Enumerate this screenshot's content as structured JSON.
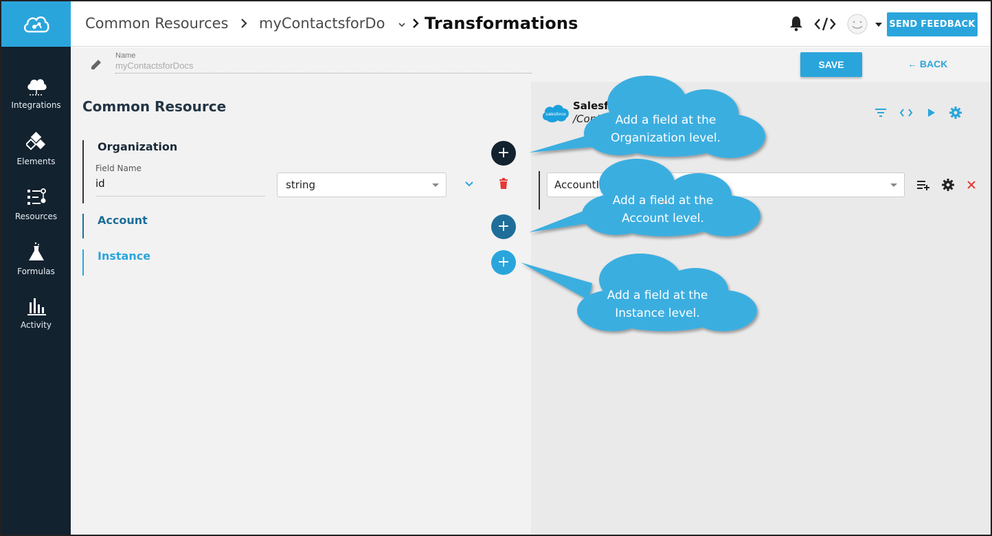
{
  "breadcrumb": {
    "item1": "Common Resources",
    "item2": "myContactsforDo",
    "title": "Transformations"
  },
  "topbar": {
    "feedback_label": "SEND FEEDBACK"
  },
  "sidebar": {
    "items": [
      {
        "label": "Integrations",
        "icon": "cloud-icon"
      },
      {
        "label": "Elements",
        "icon": "elements-icon"
      },
      {
        "label": "Resources",
        "icon": "resources-icon"
      },
      {
        "label": "Formulas",
        "icon": "flask-icon"
      },
      {
        "label": "Activity",
        "icon": "bar-chart-icon"
      }
    ]
  },
  "subheader": {
    "name_label": "Name",
    "name_value": "myContactsforDocs",
    "save_label": "SAVE",
    "back_label": "← BACK"
  },
  "left_panel": {
    "title": "Common Resource",
    "levels": [
      {
        "title": "Organization",
        "color": "#1b2a38"
      },
      {
        "title": "Account",
        "color": "#1e6e99"
      },
      {
        "title": "Instance",
        "color": "#2aa5dc"
      }
    ],
    "field_label": "Field Name",
    "field_value": "id",
    "type_value": "string"
  },
  "right_panel": {
    "logo_text": "salesforce",
    "title": "Salesf",
    "path": "/Cont",
    "mapping_value": "AccountId"
  },
  "callouts": [
    {
      "line1": "Add a field at the",
      "line2": "Organization level."
    },
    {
      "line1": "Add a field at the",
      "line2": "Account level."
    },
    {
      "line1": "Add a field at the",
      "line2": "Instance level."
    }
  ],
  "colors": {
    "brand": "#2aa5dc",
    "sidebar": "#13222f",
    "delete": "#e53935",
    "callout": "#3aaee0"
  }
}
